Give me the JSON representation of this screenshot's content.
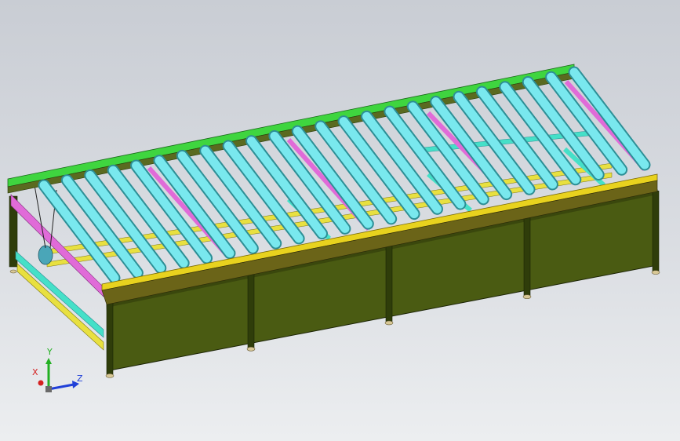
{
  "viewport": {
    "background_top": "#c9cdd4",
    "background_bottom": "#eceef0"
  },
  "model": {
    "colors": {
      "roller": "#79e8ee",
      "roller_edge": "#2d8f96",
      "top_rail_back": "#3fd53f",
      "top_rail_front": "#e8d21e",
      "panel": "#4a5b12",
      "panel_edge": "#1c2406",
      "post": "#2f3d0a",
      "cross_pink": "#e06bd8",
      "cross_cyan": "#45e0c8",
      "cross_yellow": "#e8e040",
      "foot": "#d8c896"
    }
  },
  "triad": {
    "x_label": "X",
    "y_label": "Y",
    "z_label": "Z",
    "x_color": "#d42020",
    "y_color": "#22b022",
    "z_color": "#2040d8"
  }
}
